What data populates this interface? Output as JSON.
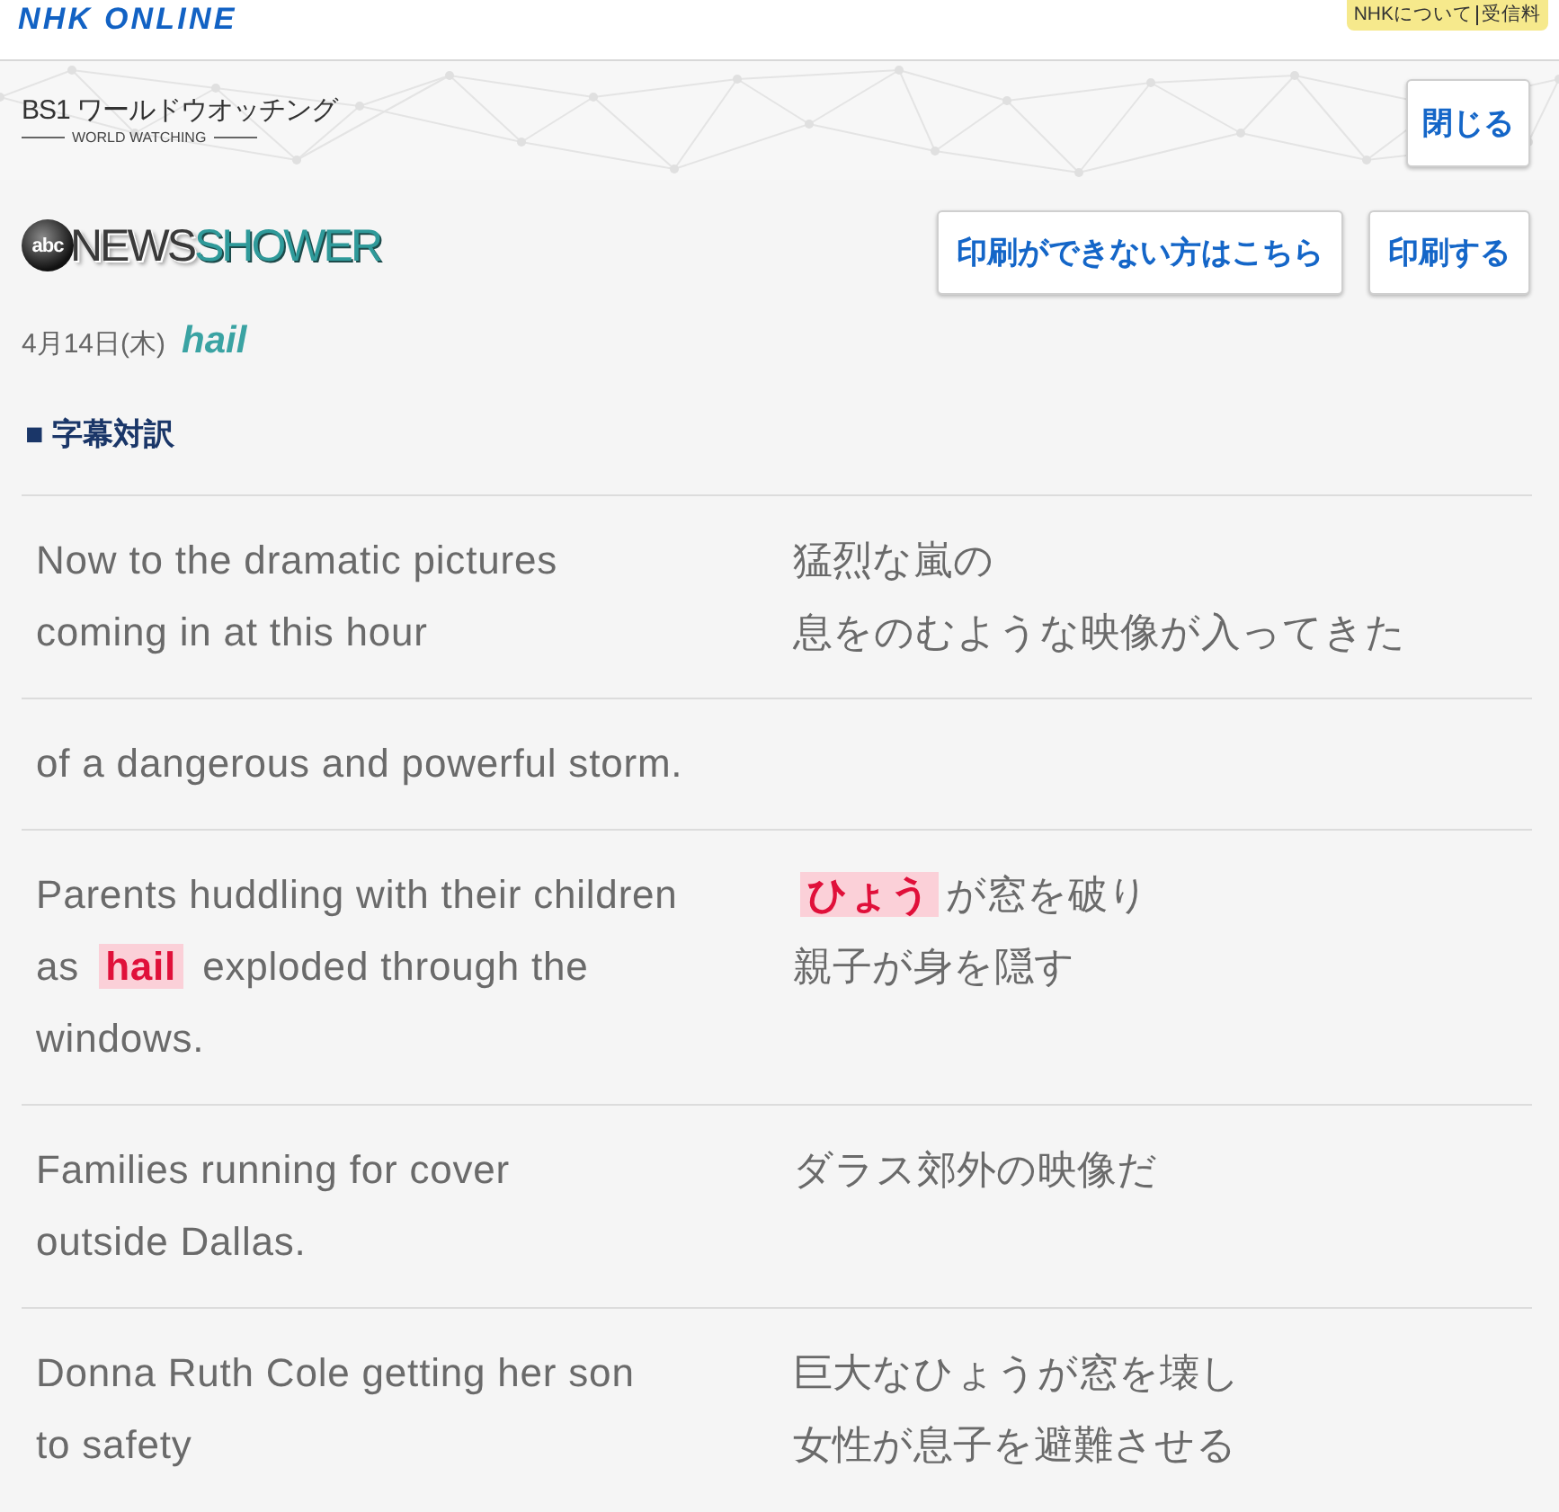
{
  "header": {
    "logo": "NHK ONLINE",
    "links": [
      "NHKについて",
      "受信料"
    ]
  },
  "program_bar": {
    "title": "BS1 ワールドウオッチング",
    "subtitle": "WORLD WATCHING",
    "close_button": "閉じる"
  },
  "show": {
    "badge": "abc",
    "name_part_1": "NEWS",
    "name_part_2": "SHOWER",
    "buttons": [
      "印刷ができない方はこちら",
      "印刷する"
    ]
  },
  "date": "4月14日(木)",
  "keyword": "hail",
  "section_title": "■ 字幕対訳",
  "subtitles": [
    {
      "en": [
        "Now to the dramatic pictures",
        "coming in at this hour"
      ],
      "ja": [
        "猛烈な嵐の",
        "息をのむような映像が入ってきた"
      ]
    },
    {
      "en": [
        "of a dangerous and powerful storm."
      ]
    },
    {
      "en": [
        "Parents huddling with their children",
        "as **hail** exploded through the",
        "windows."
      ],
      "ja": [
        "**ひょう**が窓を破り",
        "親子が身を隠す"
      ]
    },
    {
      "en": [
        "Families running for cover",
        "outside Dallas."
      ],
      "ja": [
        "ダラス郊外の映像だ"
      ]
    },
    {
      "en": [
        "Donna Ruth Cole getting her son",
        "to safety"
      ],
      "ja": [
        "巨大なひょうが窓を壊し",
        "女性が息子を避難させる"
      ]
    }
  ]
}
